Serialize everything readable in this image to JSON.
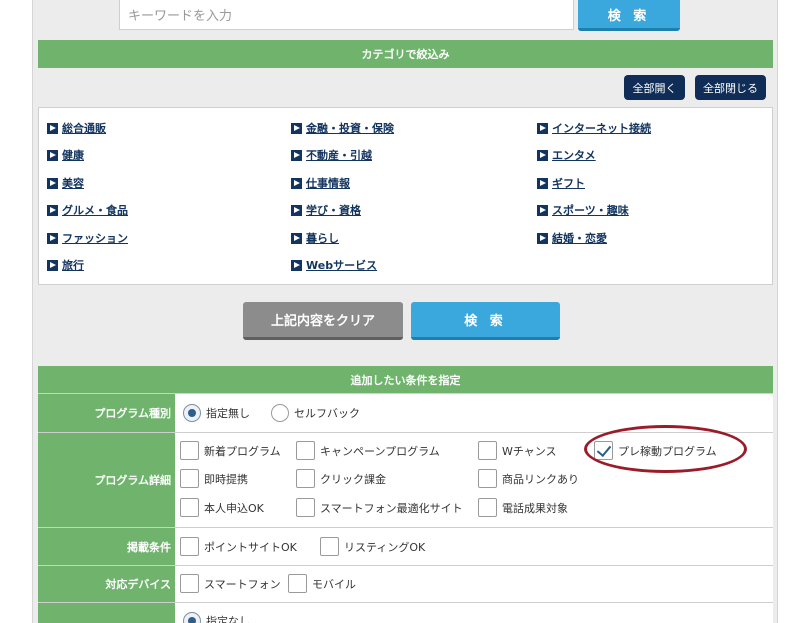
{
  "search": {
    "placeholder": "キーワードを入力",
    "button_label": "検 索"
  },
  "category_header": "カテゴリで絞込み",
  "controls": {
    "expand_all": "全部開く",
    "collapse_all": "全部閉じる"
  },
  "categories": {
    "col1": [
      "総合通販",
      "健康",
      "美容",
      "グルメ・食品",
      "ファッション",
      "旅行"
    ],
    "col2": [
      "金融・投資・保険",
      "不動産・引越",
      "仕事情報",
      "学び・資格",
      "暮らし",
      "Webサービス"
    ],
    "col3": [
      "インターネット接続",
      "エンタメ",
      "ギフト",
      "スポーツ・趣味",
      "結婚・恋愛"
    ]
  },
  "actions": {
    "clear": "上記内容をクリア",
    "search": "検 索"
  },
  "conditions_header": "追加したい条件を指定",
  "program_type": {
    "label": "プログラム種別",
    "options": [
      {
        "label": "指定無し",
        "selected": true
      },
      {
        "label": "セルフバック",
        "selected": false
      }
    ]
  },
  "program_detail": {
    "label": "プログラム詳細",
    "options": [
      {
        "label": "新着プログラム",
        "checked": false
      },
      {
        "label": "キャンペーンプログラム",
        "checked": false
      },
      {
        "label": "Wチャンス",
        "checked": false
      },
      {
        "label": "プレ稼動プログラム",
        "checked": true
      },
      {
        "label": "即時提携",
        "checked": false
      },
      {
        "label": "クリック課金",
        "checked": false
      },
      {
        "label": "商品リンクあり",
        "checked": false
      },
      {
        "label": "本人申込OK",
        "checked": false
      },
      {
        "label": "スマートフォン最適化サイト",
        "checked": false
      },
      {
        "label": "電話成果対象",
        "checked": false
      }
    ]
  },
  "listing": {
    "label": "掲載条件",
    "options": [
      {
        "label": "ポイントサイトOK",
        "checked": false
      },
      {
        "label": "リスティングOK",
        "checked": false
      }
    ]
  },
  "device": {
    "label": "対応デバイス",
    "options": [
      {
        "label": "スマートフォン",
        "checked": false
      },
      {
        "label": "モバイル",
        "checked": false
      }
    ]
  },
  "next_row": {
    "first_option": "指定なし"
  },
  "colors": {
    "green": "#6fb36c",
    "blue": "#3aa8dc",
    "navy": "#0f2d56",
    "highlight": "#9a1b2a"
  }
}
